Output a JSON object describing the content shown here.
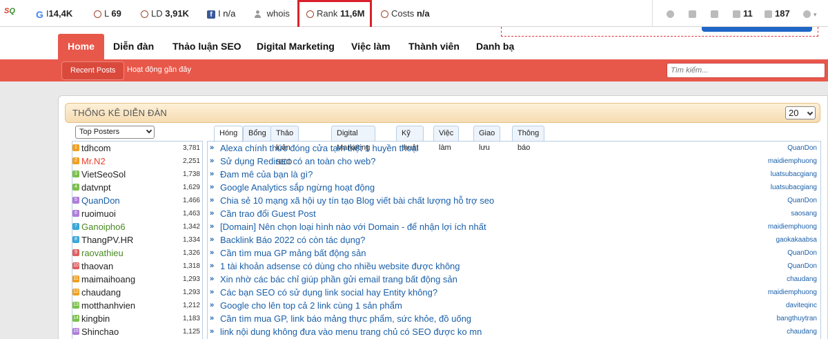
{
  "seobar": {
    "metrics": [
      {
        "name": "google",
        "prefix": "I",
        "value": "14,4K"
      },
      {
        "name": "links",
        "prefix": "L",
        "value": "69"
      },
      {
        "name": "linkdomains",
        "prefix": "LD",
        "value": "3,91K"
      },
      {
        "name": "facebook",
        "prefix": "I",
        "value": "n/a"
      },
      {
        "name": "whois",
        "prefix": "",
        "value": "whois"
      },
      {
        "name": "rank",
        "prefix": "Rank",
        "value": "11,6M"
      },
      {
        "name": "costs",
        "prefix": "Costs",
        "value": "n/a"
      }
    ],
    "right": {
      "external": "11",
      "pages": "187"
    }
  },
  "nav": {
    "tabs": [
      "Home",
      "Diễn đàn",
      "Thảo luận SEO",
      "Digital Marketing",
      "Việc làm",
      "Thành viên",
      "Danh bạ"
    ],
    "subtabs": [
      "Recent Posts",
      "Hoạt động gần đây"
    ],
    "search_placeholder": "Tìm kiếm..."
  },
  "panel": {
    "title": "THỐNG KÊ DIỄN ĐÀN",
    "count_select": "20",
    "top_select": "Top Posters"
  },
  "posters": [
    {
      "rank": "1",
      "name": "tdhcom",
      "count": "3,781",
      "color": "#222",
      "badge": "#f0a020"
    },
    {
      "rank": "2",
      "name": "Mr.N2",
      "count": "2,251",
      "color": "#e8402c",
      "badge": "#f0a020"
    },
    {
      "rank": "3",
      "name": "VietSeoSol",
      "count": "1,738",
      "color": "#222",
      "badge": "#7cc04a"
    },
    {
      "rank": "4",
      "name": "datvnpt",
      "count": "1,629",
      "color": "#222",
      "badge": "#7cc04a"
    },
    {
      "rank": "5",
      "name": "QuanDon",
      "count": "1,466",
      "color": "#1a5fa8",
      "badge": "#b07cd8"
    },
    {
      "rank": "6",
      "name": "ruoimuoi",
      "count": "1,463",
      "color": "#222",
      "badge": "#b07cd8"
    },
    {
      "rank": "7",
      "name": "Ganoipho6",
      "count": "1,342",
      "color": "#4a8a22",
      "badge": "#3aa8d8"
    },
    {
      "rank": "8",
      "name": "ThangPV.HR",
      "count": "1,334",
      "color": "#222",
      "badge": "#3aa8d8"
    },
    {
      "rank": "9",
      "name": "raovathieu",
      "count": "1,326",
      "color": "#4a8a22",
      "badge": "#e06060"
    },
    {
      "rank": "10",
      "name": "thaovan",
      "count": "1,318",
      "color": "#222",
      "badge": "#e06060"
    },
    {
      "rank": "11",
      "name": "maimaihoang",
      "count": "1,293",
      "color": "#222",
      "badge": "#f0a020"
    },
    {
      "rank": "12",
      "name": "chaudang",
      "count": "1,293",
      "color": "#222",
      "badge": "#f0a020"
    },
    {
      "rank": "13",
      "name": "motthanhvien",
      "count": "1,212",
      "color": "#222",
      "badge": "#7cc04a"
    },
    {
      "rank": "14",
      "name": "kingbin",
      "count": "1,183",
      "color": "#222",
      "badge": "#7cc04a"
    },
    {
      "rank": "15",
      "name": "Shinchao",
      "count": "1,125",
      "color": "#222",
      "badge": "#b07cd8"
    }
  ],
  "thread_tabs": [
    "Hóng",
    "Bổng",
    "Thảo luận SEO",
    "Digital Marketing",
    "Kỹ thuật",
    "Việc làm",
    "Giao lưu",
    "Thông báo"
  ],
  "threads": [
    {
      "title": "Alexa chính thức đóng cửa tạm biệt 1 huyền thoại",
      "author": "QuanDon"
    },
    {
      "title": "Sử dụng Redirect có an toàn cho web?",
      "author": "maidiemphuong"
    },
    {
      "title": "Đam mê của bạn là gì?",
      "author": "luatsubacgiang"
    },
    {
      "title": "Google Analytics sắp ngừng hoạt động",
      "author": "luatsubacgiang"
    },
    {
      "title": "Chia sẻ 10 mạng xã hội uy tín tạo Blog viết bài chất lượng hỗ trợ seo",
      "author": "QuanDon"
    },
    {
      "title": "Cần trao đổi Guest Post",
      "author": "saosang"
    },
    {
      "title": "[Domain] Nên chọn loại hình nào với Domain - để nhận lợi ích nhất",
      "author": "maidiemphuong"
    },
    {
      "title": "Backlink Báo 2022 có còn tác dụng?",
      "author": "gaokakaabsa"
    },
    {
      "title": "Cần tìm mua GP mảng bất động sản",
      "author": "QuanDon"
    },
    {
      "title": "1 tài khoản adsense có dùng cho nhiều website được không",
      "author": "QuanDon"
    },
    {
      "title": "Xin nhờ các bác chỉ giúp phần gửi email trang bất động sản",
      "author": "chaudang"
    },
    {
      "title": "Các bạn SEO có sử dụng link social hay Entity không?",
      "author": "maidiemphuong"
    },
    {
      "title": "Google cho lên top cả 2 link cùng 1 sản phẩm",
      "author": "daviteqinc"
    },
    {
      "title": "Cần tìm mua GP, link báo mảng thực phẩm, sức khỏe, đồ uống",
      "author": "bangthuytran"
    },
    {
      "title": "link nội dung không đưa vào menu trang chủ có SEO được ko mn",
      "author": "chaudang"
    }
  ]
}
